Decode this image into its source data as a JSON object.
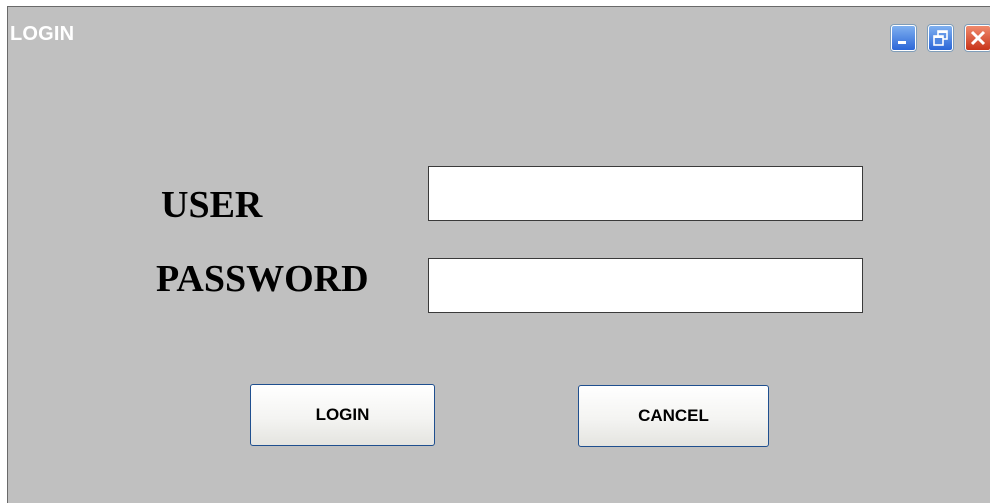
{
  "window": {
    "title": "LOGIN",
    "controls": {
      "minimize_icon": "minimize-icon",
      "restore_icon": "restore-icon",
      "close_icon": "close-icon"
    }
  },
  "form": {
    "user_label": "USER",
    "user_value": "",
    "password_label": "PASSWORD",
    "password_value": ""
  },
  "actions": {
    "login_label": "LOGIN",
    "cancel_label": "CANCEL"
  },
  "colors": {
    "window_background": "#c0c0c0",
    "title_text": "#ffffff",
    "button_border": "#1f4f8f",
    "close_button": "#c8341a",
    "control_button": "#2b66d8"
  }
}
